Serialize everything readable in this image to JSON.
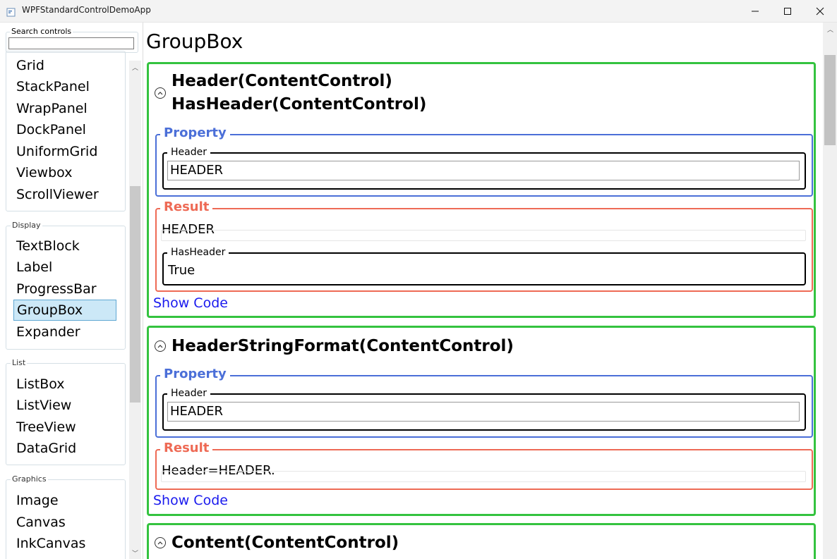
{
  "window": {
    "title": "WPFStandardControlDemoApp"
  },
  "sidebar": {
    "search_label": "Search controls",
    "search_value": "",
    "layout_items": [
      "Grid",
      "StackPanel",
      "WrapPanel",
      "DockPanel",
      "UniformGrid",
      "Viewbox",
      "ScrollViewer"
    ],
    "display": {
      "label": "Display",
      "items": [
        "TextBlock",
        "Label",
        "ProgressBar",
        "GroupBox",
        "Expander"
      ],
      "selected": "GroupBox"
    },
    "list": {
      "label": "List",
      "items": [
        "ListBox",
        "ListView",
        "TreeView",
        "DataGrid"
      ]
    },
    "graphics": {
      "label": "Graphics",
      "items": [
        "Image",
        "Canvas",
        "InkCanvas"
      ]
    }
  },
  "main": {
    "title": "GroupBox",
    "sections": [
      {
        "heading_lines": [
          "Header(ContentControl)",
          "HasHeader(ContentControl)"
        ],
        "property_label": "Property",
        "field_label": "Header",
        "field_value": "HEADER",
        "result_label": "Result",
        "result_text": "HEADER",
        "result_field_label": "HasHeader",
        "result_field_value": "True",
        "show_code": "Show Code"
      },
      {
        "heading_lines": [
          "HeaderStringFormat(ContentControl)"
        ],
        "property_label": "Property",
        "field_label": "Header",
        "field_value": "HEADER",
        "result_label": "Result",
        "result_text": "Header=HEADER.",
        "show_code": "Show Code"
      },
      {
        "heading_lines": [
          "Content(ContentControl)"
        ]
      }
    ]
  },
  "colors": {
    "demo_border": "#34c33f",
    "property_color": "#4b6fd8",
    "result_color": "#ee6a55",
    "link_color": "#1a1aee",
    "selection_bg": "#cce8f7"
  }
}
